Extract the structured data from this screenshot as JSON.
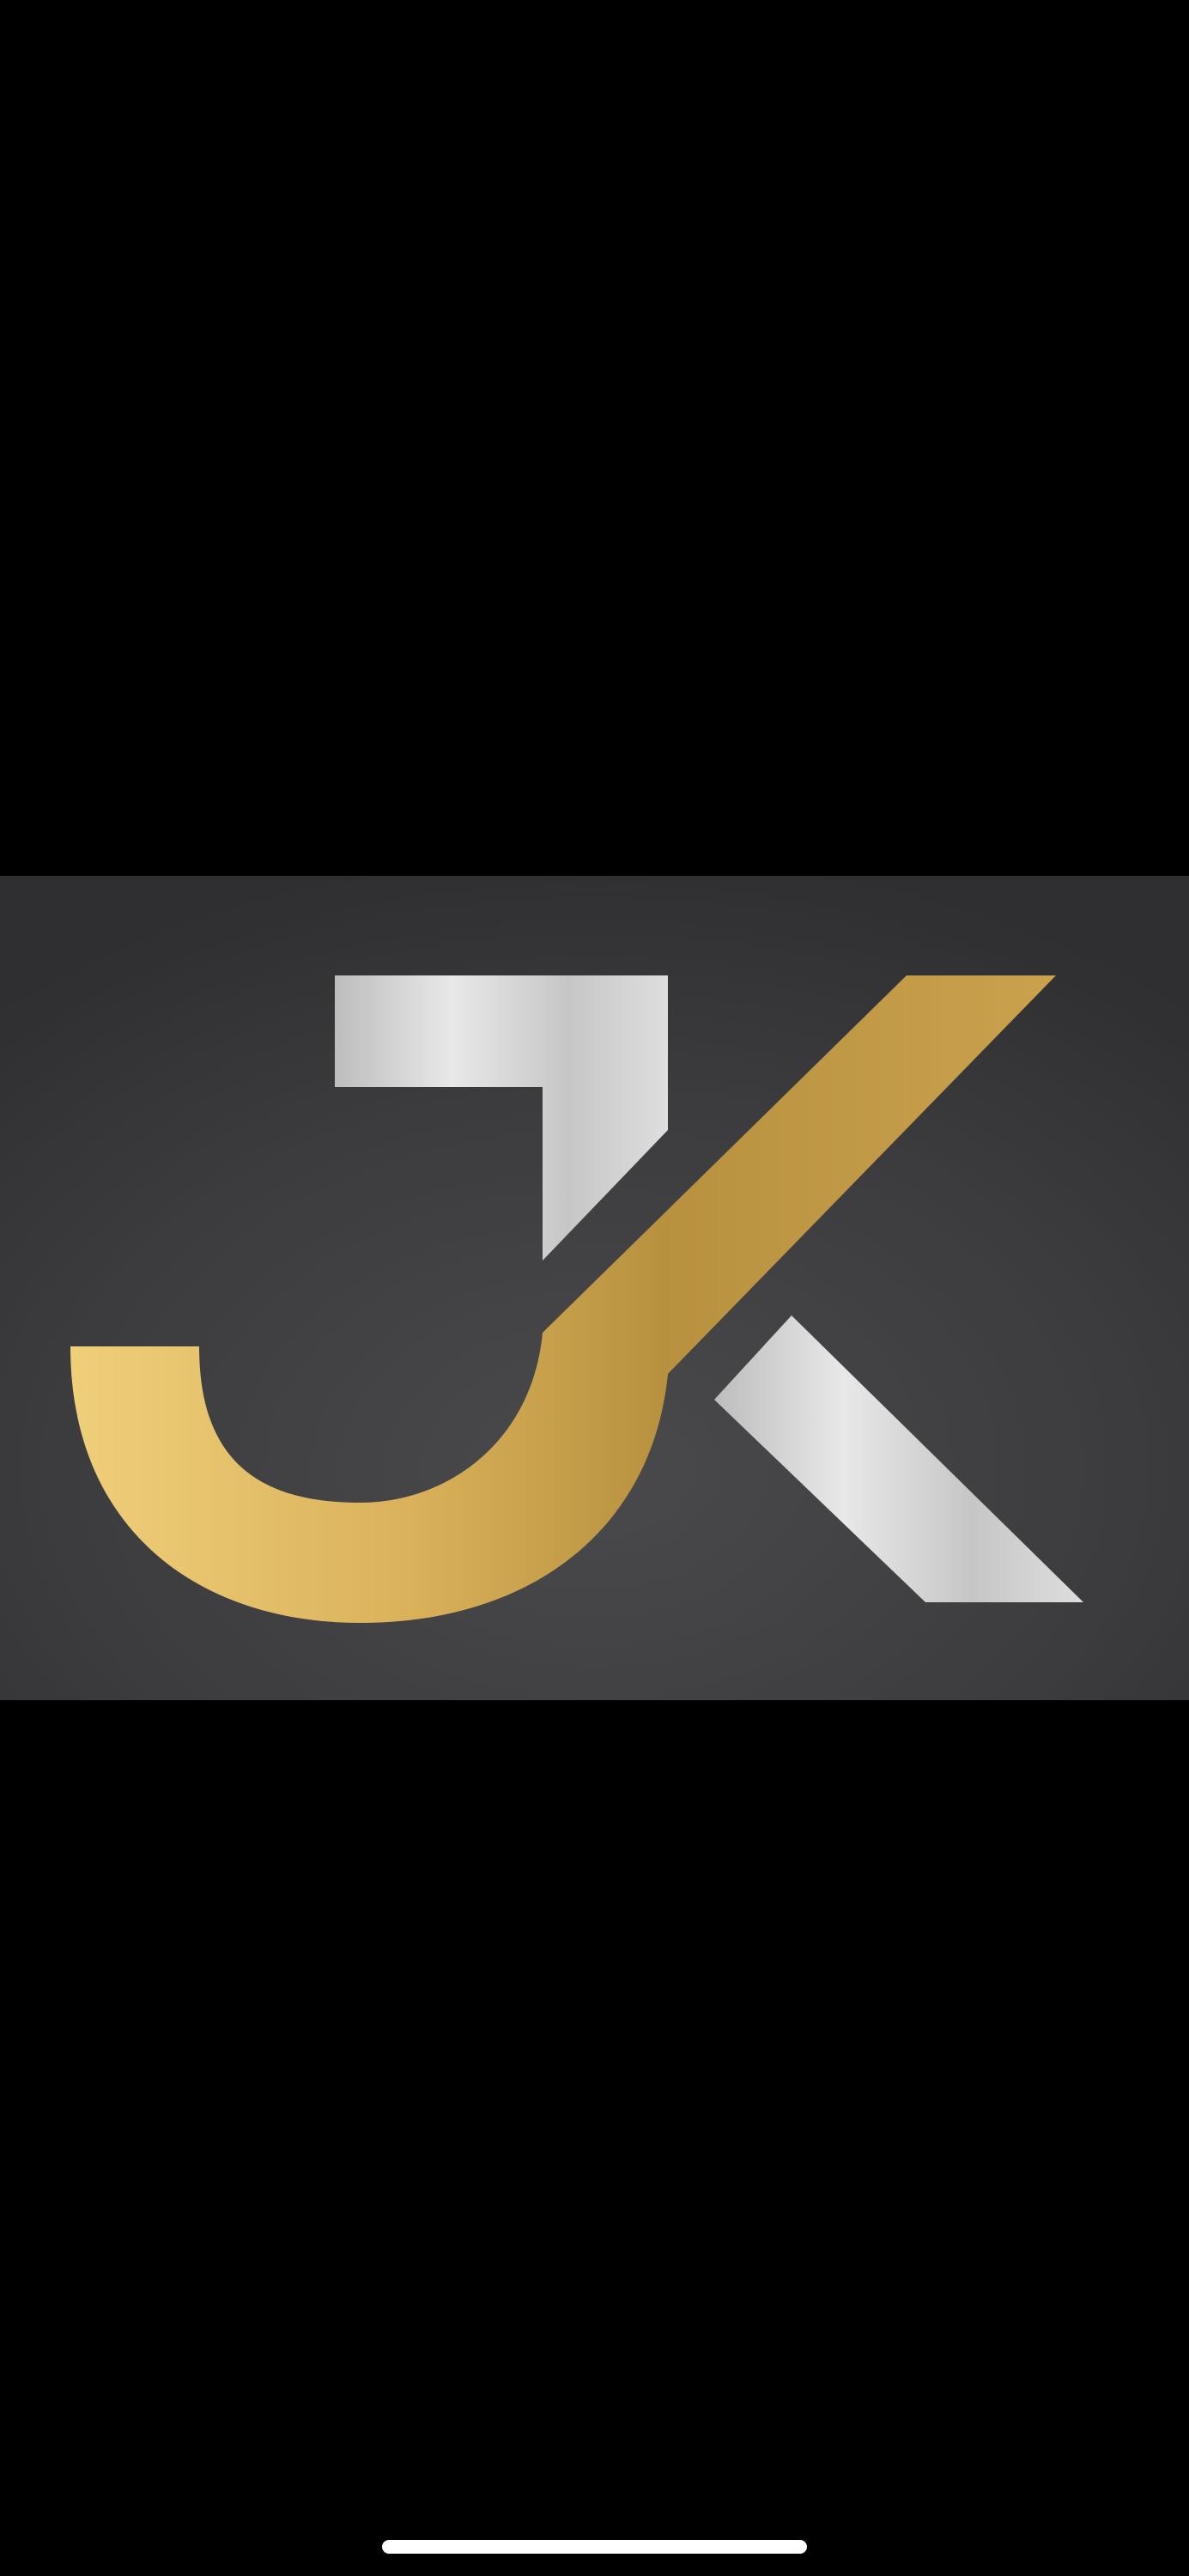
{
  "viewer": {
    "image": {
      "subject": "jk-monogram-logo",
      "logo_text": "JK",
      "background_color": "#3a3a3c",
      "gold_color": "#c9a24a",
      "silver_color": "#d4d4d4"
    }
  },
  "system": {
    "home_indicator_color": "#ffffff"
  }
}
